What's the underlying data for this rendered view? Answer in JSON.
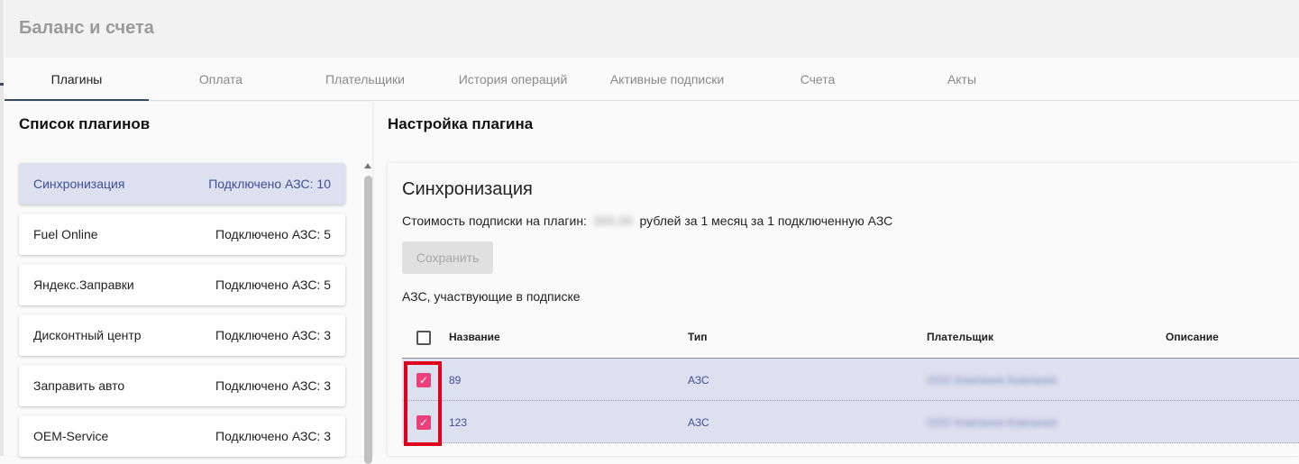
{
  "header": {
    "title": "Баланс и счета"
  },
  "tabs": [
    {
      "label": "Плагины",
      "active": true
    },
    {
      "label": "Оплата"
    },
    {
      "label": "Плательщики"
    },
    {
      "label": "История операций"
    },
    {
      "label": "Активные подписки"
    },
    {
      "label": "Счета"
    },
    {
      "label": "Акты"
    }
  ],
  "plugins": {
    "title": "Список плагинов",
    "items": [
      {
        "name": "Синхронизация",
        "count": "Подключено АЗС: 10",
        "selected": true
      },
      {
        "name": "Fuel Online",
        "count": "Подключено АЗС: 5"
      },
      {
        "name": "Яндекс.Заправки",
        "count": "Подключено АЗС: 5"
      },
      {
        "name": "Дисконтный центр",
        "count": "Подключено АЗС: 3"
      },
      {
        "name": "Заправить авто",
        "count": "Подключено АЗС: 3"
      },
      {
        "name": "OEM-Service",
        "count": "Подключено АЗС: 3"
      }
    ]
  },
  "settings": {
    "title": "Настройка плагина",
    "plugin_name": "Синхронизация",
    "price_prefix": "Стоимость подписки на плагин:",
    "price_suffix": "рублей за 1 месяц за 1 подключенную АЗС",
    "save_label": "Сохранить",
    "stations_label": "АЗС, участвующие в подписке",
    "table": {
      "columns": [
        "Название",
        "Тип",
        "Плательщик",
        "Описание"
      ],
      "rows": [
        {
          "name": "89",
          "type": "АЗС",
          "checked": true
        },
        {
          "name": "123",
          "type": "АЗС",
          "checked": true
        }
      ]
    }
  },
  "colors": {
    "selected_bg": "#dde0ef",
    "selected_text": "#3f4f9a",
    "checkbox": "#ec407a",
    "highlight": "#e0001b",
    "tab_indicator": "#3b4a5a"
  }
}
